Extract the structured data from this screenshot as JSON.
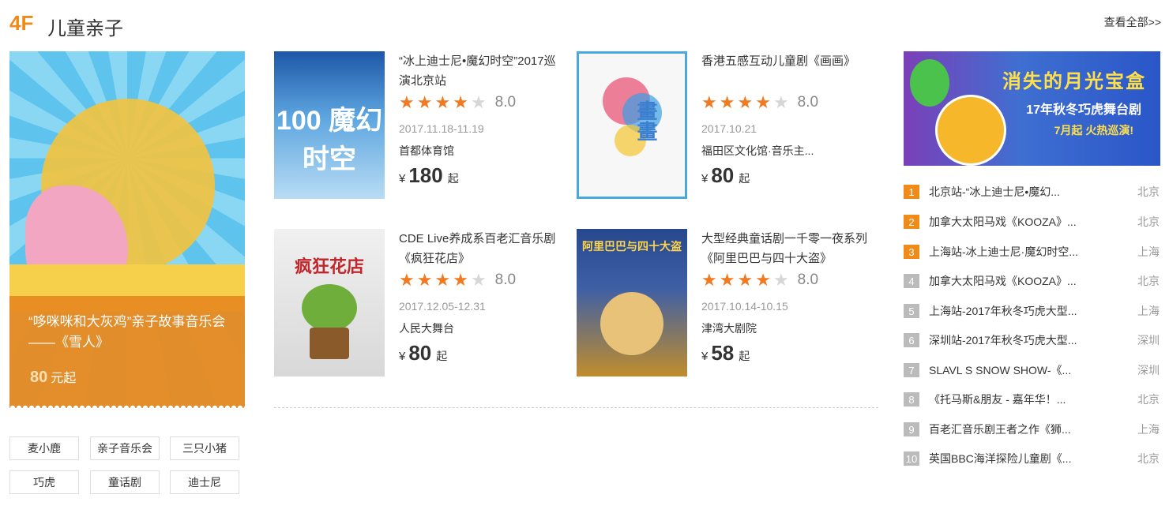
{
  "header": {
    "floor": "4F",
    "title": "儿童亲子",
    "view_all": "查看全部>>"
  },
  "feature": {
    "title": "“哆咪咪和大灰鸡”亲子故事音乐会——《雪人》",
    "price": "80",
    "price_unit": "元起"
  },
  "tags": [
    "麦小鹿",
    "亲子音乐会",
    "三只小猪",
    "巧虎",
    "童话剧",
    "迪士尼"
  ],
  "shows": [
    {
      "name": "“冰上迪士尼•魔幻时空”2017巡演北京站",
      "score": "8.0",
      "stars": 4,
      "date": "2017.11.18-11.19",
      "venue": "首都体育馆",
      "price": "180",
      "yen": "¥",
      "qi": "起",
      "poster_text": "100 魔幻时空"
    },
    {
      "name": "香港五感互动儿童剧《画画》",
      "score": "8.0",
      "stars": 4,
      "date": "2017.10.21",
      "venue": "福田区文化馆·音乐主...",
      "price": "80",
      "yen": "¥",
      "qi": "起",
      "poster_text": "畫畫"
    },
    {
      "name": "CDE Live养成系百老汇音乐剧《疯狂花店》",
      "score": "8.0",
      "stars": 4,
      "date": "2017.12.05-12.31",
      "venue": "人民大舞台",
      "price": "80",
      "yen": "¥",
      "qi": "起",
      "poster_text": "疯狂花店"
    },
    {
      "name": "大型经典童话剧一千零一夜系列《阿里巴巴与四十大盗》",
      "score": "8.0",
      "stars": 4,
      "date": "2017.10.14-10.15",
      "venue": "津湾大剧院",
      "price": "58",
      "yen": "¥",
      "qi": "起",
      "poster_text": "阿里巴巴与四十大盗"
    }
  ],
  "side_banner": {
    "title": "消失的月光宝盒",
    "subtitle": "17年秋冬巧虎舞台剧",
    "tagline": "7月起 火热巡演!"
  },
  "ranking": [
    {
      "num": "1",
      "title": "北京站-“冰上迪士尼•魔幻...",
      "city": "北京"
    },
    {
      "num": "2",
      "title": "加拿大太阳马戏《KOOZA》...",
      "city": "北京"
    },
    {
      "num": "3",
      "title": "上海站-冰上迪士尼·魔幻时空...",
      "city": "上海"
    },
    {
      "num": "4",
      "title": "加拿大太阳马戏《KOOZA》...",
      "city": "北京"
    },
    {
      "num": "5",
      "title": "上海站-2017年秋冬巧虎大型...",
      "city": "上海"
    },
    {
      "num": "6",
      "title": "深圳站-2017年秋冬巧虎大型...",
      "city": "深圳"
    },
    {
      "num": "7",
      "title": "SLAVL S SNOW SHOW-《...",
      "city": "深圳"
    },
    {
      "num": "8",
      "title": "《托马斯&朋友 - 嘉年华！...",
      "city": "北京"
    },
    {
      "num": "9",
      "title": "百老汇音乐剧王者之作《狮...",
      "city": "上海"
    },
    {
      "num": "10",
      "title": "英国BBC海洋探险儿童剧《...",
      "city": "北京"
    }
  ],
  "colors": {
    "accent": "#f08b1a",
    "star_on": "#f07a22",
    "star_off": "#d7d7d7"
  }
}
